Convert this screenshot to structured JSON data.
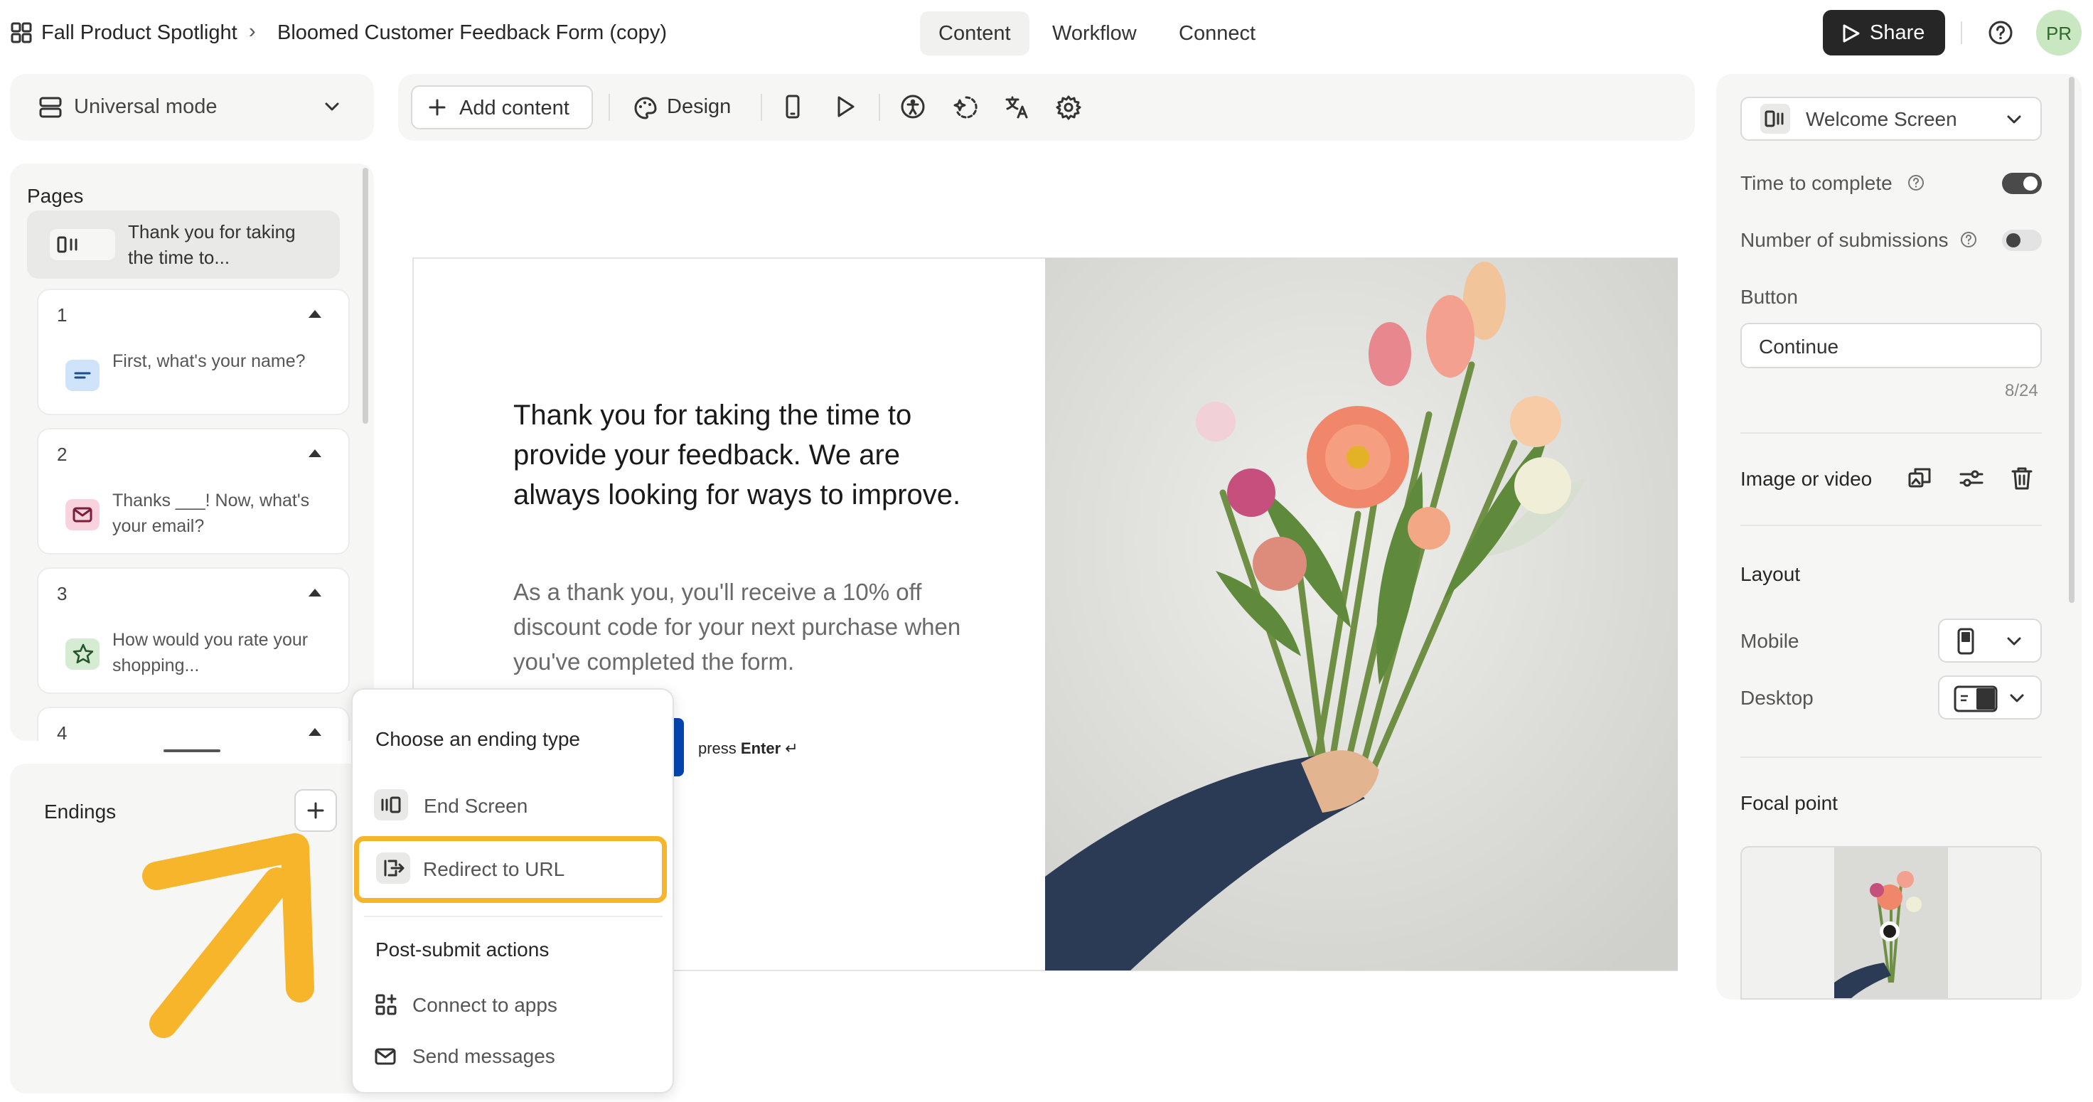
{
  "header": {
    "breadcrumb_workspace": "Fall Product Spotlight",
    "breadcrumb_sep": "›",
    "form_title": "Bloomed Customer Feedback Form (copy)",
    "tabs": [
      {
        "label": "Content",
        "active": true
      },
      {
        "label": "Workflow",
        "active": false
      },
      {
        "label": "Connect",
        "active": false
      }
    ],
    "share_label": "Share",
    "avatar_initials": "PR"
  },
  "sidebar": {
    "mode_label": "Universal mode",
    "pages_heading": "Pages",
    "welcome_item": "Thank you for taking the time to...",
    "questions": [
      {
        "number": "1",
        "text": "First, what's your name?",
        "icon": "short-text-icon"
      },
      {
        "number": "2",
        "text": "Thanks ___! Now, what's your email?",
        "icon": "email-icon"
      },
      {
        "number": "3",
        "text": "How would you rate your shopping...",
        "icon": "star-icon"
      },
      {
        "number": "4",
        "text": "",
        "icon": ""
      }
    ],
    "endings_heading": "Endings"
  },
  "toolbar": {
    "add_content_label": "Add content",
    "design_label": "Design",
    "icons": [
      "phone-preview-icon",
      "play-icon",
      "accessibility-icon",
      "ai-assist-icon",
      "translate-icon",
      "settings-icon"
    ]
  },
  "canvas": {
    "headline": "Thank you for taking the time to provide your feedback. We are always looking for ways to improve.",
    "body": "As a thank you, you'll receive a 10% off discount code for your next purchase when you've completed the form.",
    "press_label": "press",
    "enter_label": "Enter",
    "enter_glyph": "↵"
  },
  "popup": {
    "heading": "Choose an ending type",
    "options": [
      "End Screen",
      "Redirect to URL"
    ],
    "highlighted": "Redirect to URL",
    "post_heading": "Post-submit actions",
    "post_options": [
      "Connect to apps",
      "Send messages"
    ]
  },
  "settings": {
    "screen_select": "Welcome Screen",
    "time_to_complete": "Time to complete",
    "time_to_complete_on": true,
    "number_of_submissions": "Number of submissions",
    "number_of_submissions_on": false,
    "button_label": "Button",
    "button_value": "Continue",
    "char_count": "8/24",
    "image_or_video": "Image or video",
    "layout_heading": "Layout",
    "mobile_label": "Mobile",
    "desktop_label": "Desktop",
    "focal_point_heading": "Focal point"
  },
  "colors": {
    "accent_highlight": "#f7b52c",
    "share_button": "#262627",
    "submit_button": "#0445af",
    "avatar_bg": "#c9e7c1",
    "avatar_text": "#2e6b2a"
  }
}
